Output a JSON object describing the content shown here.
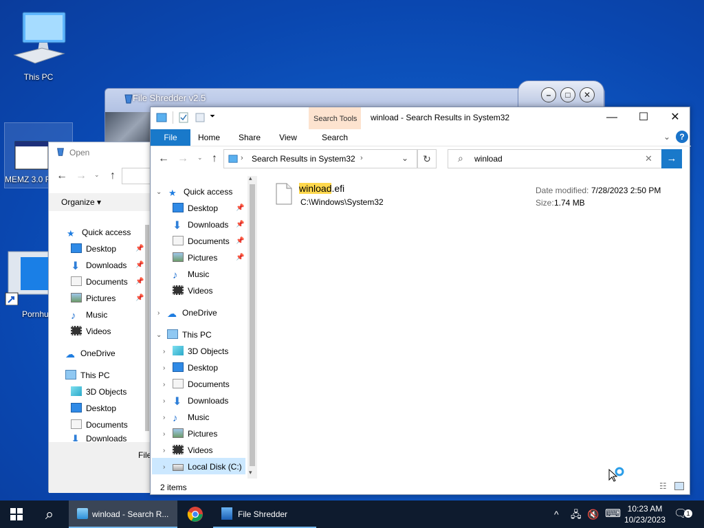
{
  "desktop": {
    "icons": [
      {
        "label": "This PC"
      },
      {
        "label": "MEMZ 3.0 R"
      },
      {
        "label": "Pornhu"
      }
    ]
  },
  "shredder": {
    "title": "File Shredder v2.5"
  },
  "open_dialog": {
    "title": "Open",
    "organize": "Organize",
    "file_label": "File",
    "tree": [
      {
        "label": "Quick access"
      },
      {
        "label": "Desktop"
      },
      {
        "label": "Downloads"
      },
      {
        "label": "Documents"
      },
      {
        "label": "Pictures"
      },
      {
        "label": "Music"
      },
      {
        "label": "Videos"
      },
      {
        "label": "OneDrive"
      },
      {
        "label": "This PC"
      },
      {
        "label": "3D Objects"
      },
      {
        "label": "Desktop"
      },
      {
        "label": "Documents"
      },
      {
        "label": "Downloads"
      }
    ]
  },
  "explorer": {
    "window_title": "winload - Search Results in System32",
    "context_tab": "Search Tools",
    "ribbon_tabs": [
      "File",
      "Home",
      "Share",
      "View",
      "Search"
    ],
    "address": "Search Results in System32",
    "search_value": "winload",
    "nav": [
      {
        "label": "Quick access"
      },
      {
        "label": "Desktop"
      },
      {
        "label": "Downloads"
      },
      {
        "label": "Documents"
      },
      {
        "label": "Pictures"
      },
      {
        "label": "Music"
      },
      {
        "label": "Videos"
      },
      {
        "label": "OneDrive"
      },
      {
        "label": "This PC"
      },
      {
        "label": "3D Objects"
      },
      {
        "label": "Desktop"
      },
      {
        "label": "Documents"
      },
      {
        "label": "Downloads"
      },
      {
        "label": "Music"
      },
      {
        "label": "Pictures"
      },
      {
        "label": "Videos"
      },
      {
        "label": "Local Disk (C:)"
      }
    ],
    "result": {
      "name_highlight": "winload",
      "name_rest": ".efi",
      "path": "C:\\Windows\\System32",
      "date_label": "Date modified:",
      "date_value": "7/28/2023 2:50 PM",
      "size_label": "Size:",
      "size_value": "1.74 MB"
    },
    "status": "2 items"
  },
  "taskbar": {
    "items": [
      {
        "label": "winload - Search R..."
      },
      {
        "label": "File Shredder"
      }
    ],
    "time": "10:23 AM",
    "date": "10/23/2023",
    "notif_count": "1"
  },
  "colors": {
    "accent": "#0063b1",
    "file_tab": "#1979ca",
    "highlight": "#ffd84d",
    "context_tab": "#fde3cf"
  }
}
